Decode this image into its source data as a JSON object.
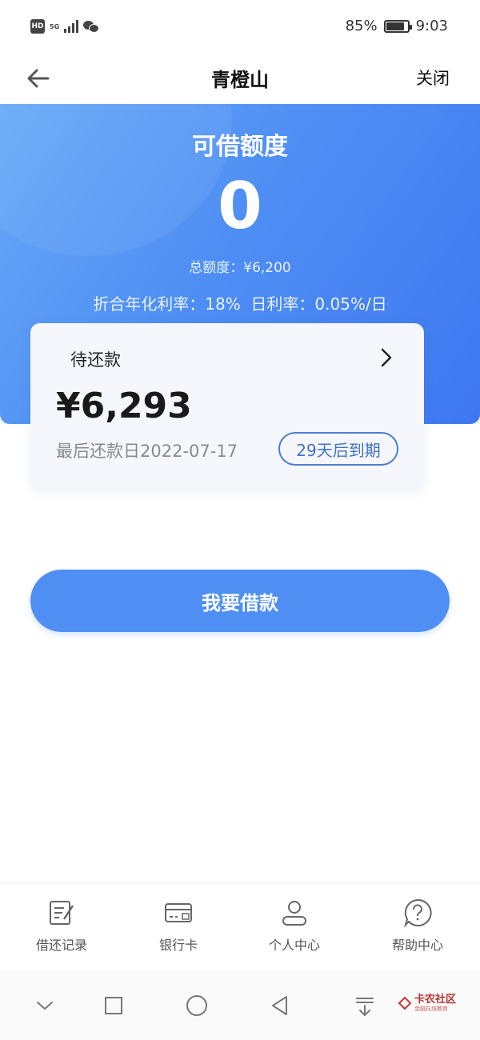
{
  "status_bar": {
    "hd": "HD",
    "network": "5G",
    "battery": "85%",
    "battery_level": 0.85,
    "time": "9:03"
  },
  "nav": {
    "title": "青橙山",
    "close": "关闭",
    "back_icon": "arrow-left-icon"
  },
  "hero": {
    "title": "可借额度",
    "amount": "0",
    "total": "总额度：¥6,200",
    "rates": "折合年化利率：18%  日利率：0.05%/日"
  },
  "repay_card": {
    "title": "待还款",
    "amount": "¥6,293",
    "due_date": "最后还款日2022-07-17",
    "badge": "29天后到期"
  },
  "borrow_button": "我要借款",
  "tabs": [
    {
      "label": "借还记录",
      "icon": "edit-record-icon"
    },
    {
      "label": "银行卡",
      "icon": "bank-card-icon"
    },
    {
      "label": "个人中心",
      "icon": "user-icon"
    },
    {
      "label": "帮助中心",
      "icon": "help-icon"
    }
  ],
  "watermark": {
    "text": "卡农社区",
    "sub": "金融在线教育"
  },
  "colors": {
    "accent": "#4f8ff4",
    "badge": "#4a7fd0"
  }
}
